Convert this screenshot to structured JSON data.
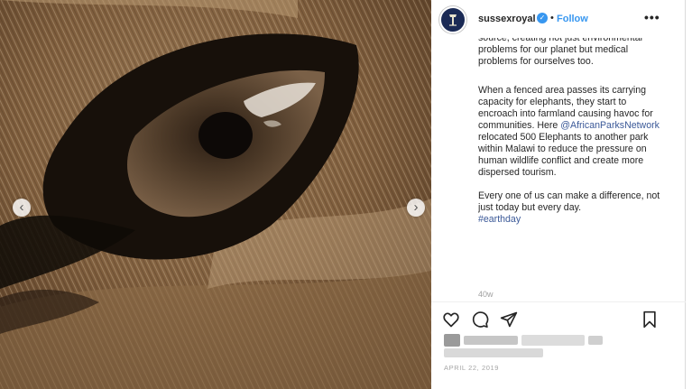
{
  "post": {
    "username": "sussexroyal",
    "separator": "•",
    "follow_label": "Follow",
    "more_label": "•••",
    "caption_partial": "source, creating not just environmental problems for our planet but medical problems for ourselves too.",
    "caption_p2_before": "When a fenced area passes its carrying capacity for elephants, they start to encroach into farmland causing havoc for communities. Here",
    "caption_mention": "@AfricanParksNetwork",
    "caption_p2_after": "relocated 500 Elephants to another park within Malawi to reduce the pressure on human wildlife conflict and create more dispersed tourism.",
    "caption_p3": "Every one of us can make a difference, not just today but every day.",
    "caption_hashtag": "#earthday",
    "time_ago": "40w",
    "date": "APRIL 22, 2019"
  },
  "media": {
    "prev_label": "‹",
    "next_label": "›"
  },
  "icons": {
    "verified": "verified-badge-icon",
    "like": "heart-icon",
    "comment": "comment-icon",
    "share": "paper-plane-icon",
    "save": "bookmark-icon"
  },
  "colors": {
    "link": "#3b5998",
    "follow": "#3897f0",
    "verified": "#3897f0"
  }
}
